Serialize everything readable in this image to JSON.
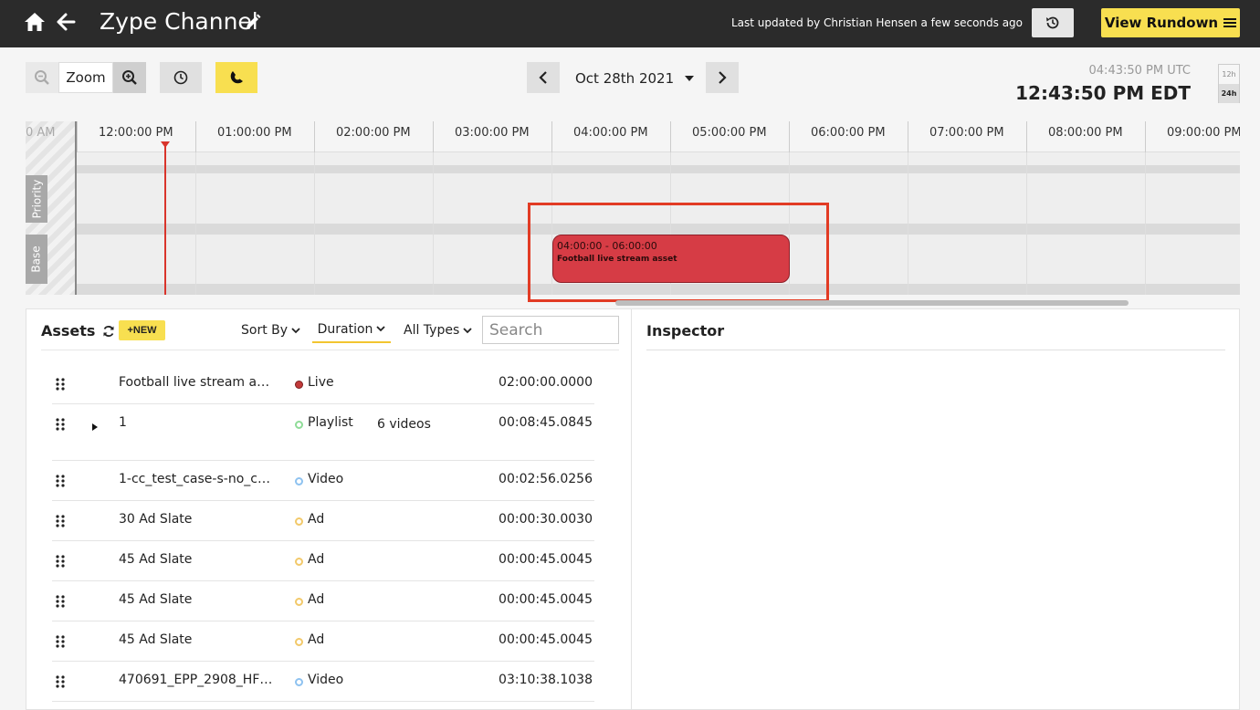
{
  "header": {
    "title": "Zype Channel",
    "last_updated": "Last updated by Christian Hensen a few seconds ago",
    "view_rundown_label": "View Rundown"
  },
  "toolbar": {
    "zoom_label": "Zoom",
    "date_label": "Oct 28th 2021",
    "utc_time": "04:43:50 PM UTC",
    "local_time": "12:43:50 PM EDT",
    "format_12h": "12h",
    "format_24h": "24h"
  },
  "timeline": {
    "left_partial_label": "0 AM",
    "hour_labels": [
      "12:00:00 PM",
      "01:00:00 PM",
      "02:00:00 PM",
      "03:00:00 PM",
      "04:00:00 PM",
      "05:00:00 PM",
      "06:00:00 PM",
      "07:00:00 PM",
      "08:00:00 PM",
      "09:00:00 PM"
    ],
    "rows": [
      "Priority",
      "Base"
    ],
    "event": {
      "time_range": "04:00:00 - 06:00:00",
      "title": "Football live stream asset",
      "color": "#d63c45"
    },
    "playhead_color": "#d9342b"
  },
  "assets": {
    "title": "Assets",
    "new_label": "+NEW",
    "sort_by_label": "Sort By",
    "duration_label": "Duration",
    "all_types_label": "All Types",
    "search_placeholder": "Search",
    "items": [
      {
        "name": "Football live stream as...",
        "type": "Live",
        "count": "",
        "duration": "02:00:00.0000",
        "dot_color": "#c23a3a",
        "expandable": false
      },
      {
        "name": "1",
        "type": "Playlist",
        "count": "6 videos",
        "duration": "00:08:45.0845",
        "dot_color": "#8fdc98",
        "expandable": true
      },
      {
        "name": "1-cc_test_case-s-no_cc....",
        "type": "Video",
        "count": "",
        "duration": "00:02:56.0256",
        "dot_color": "#8ec2f0",
        "expandable": false
      },
      {
        "name": "30 Ad Slate",
        "type": "Ad",
        "count": "",
        "duration": "00:00:30.0030",
        "dot_color": "#f2c96a",
        "expandable": false
      },
      {
        "name": "45 Ad Slate",
        "type": "Ad",
        "count": "",
        "duration": "00:00:45.0045",
        "dot_color": "#f2c96a",
        "expandable": false
      },
      {
        "name": "45 Ad Slate",
        "type": "Ad",
        "count": "",
        "duration": "00:00:45.0045",
        "dot_color": "#f2c96a",
        "expandable": false
      },
      {
        "name": "45 Ad Slate",
        "type": "Ad",
        "count": "",
        "duration": "00:00:45.0045",
        "dot_color": "#f2c96a",
        "expandable": false
      },
      {
        "name": "470691_EPP_2908_HF_I...",
        "type": "Video",
        "count": "",
        "duration": "03:10:38.1038",
        "dot_color": "#8ec2f0",
        "expandable": false
      }
    ]
  },
  "inspector": {
    "title": "Inspector"
  }
}
